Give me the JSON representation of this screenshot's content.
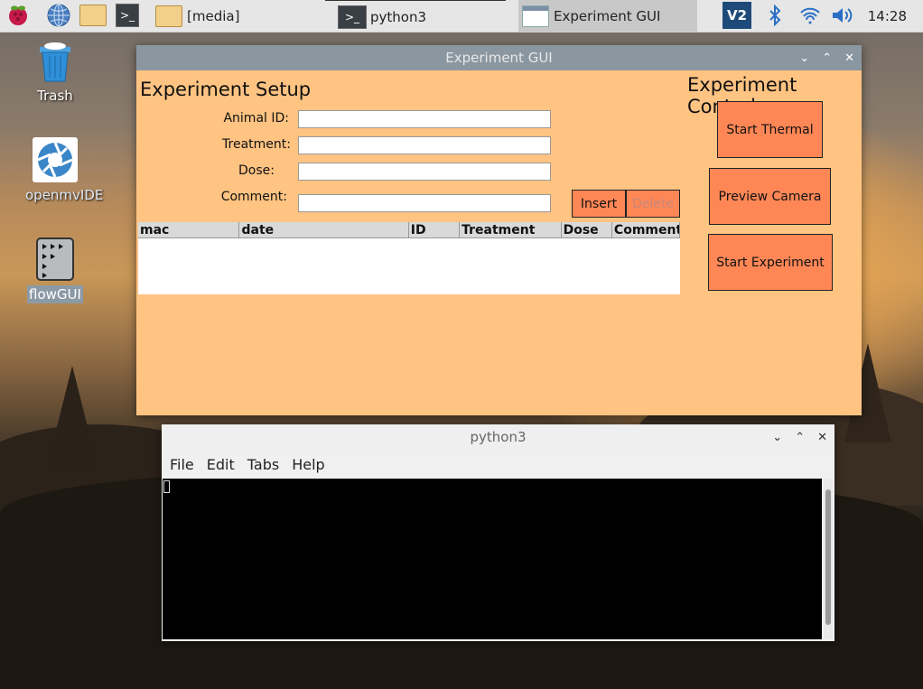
{
  "taskbar": {
    "tasks": [
      {
        "label": "[media]"
      },
      {
        "label": "python3"
      },
      {
        "label": "Experiment GUI"
      }
    ],
    "clock": "14:28",
    "vnc_label": "V2"
  },
  "desktop": {
    "icons": [
      {
        "label": "Trash"
      },
      {
        "label": "openmvIDE"
      },
      {
        "label": "flowGUI"
      }
    ]
  },
  "experiment_window": {
    "title": "Experiment GUI",
    "setup": {
      "heading": "Experiment Setup",
      "fields": [
        {
          "label": "Animal ID:",
          "value": ""
        },
        {
          "label": "Treatment:",
          "value": ""
        },
        {
          "label": "Dose:",
          "value": ""
        },
        {
          "label": "Comment:",
          "value": ""
        }
      ],
      "insert_label": "Insert",
      "delete_label": "Delete"
    },
    "table": {
      "columns": [
        "mac",
        "date",
        "ID",
        "Treatment",
        "Dose",
        "Comment"
      ],
      "rows": []
    },
    "control": {
      "heading": "Experiment Control",
      "start_thermal": "Start Thermal",
      "preview_camera": "Preview Camera",
      "start_experiment": "Start Experiment"
    },
    "colors": {
      "background": "#ffc382",
      "button": "#ff8756"
    }
  },
  "terminal_window": {
    "title": "python3",
    "menu": [
      "File",
      "Edit",
      "Tabs",
      "Help"
    ]
  }
}
